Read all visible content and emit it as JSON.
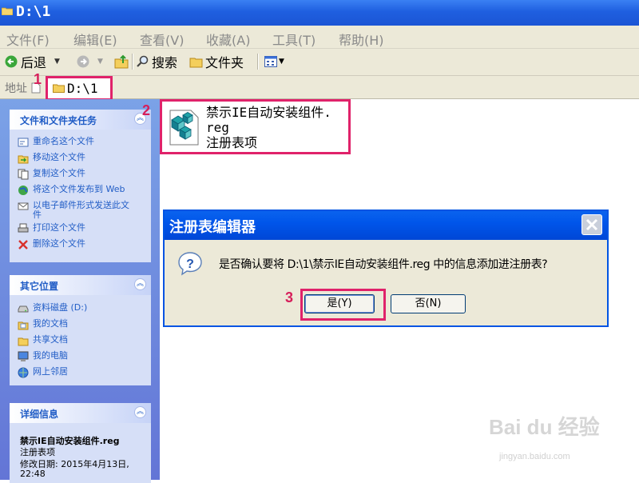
{
  "window": {
    "title": "D:\\1"
  },
  "menu": [
    "文件(F)",
    "编辑(E)",
    "查看(V)",
    "收藏(A)",
    "工具(T)",
    "帮助(H)"
  ],
  "toolbar": {
    "back": "后退",
    "search": "搜索",
    "folders": "文件夹"
  },
  "address": {
    "label": "地址",
    "value": "D:\\1"
  },
  "annotations": {
    "step1": "1",
    "step2": "2",
    "step3": "3"
  },
  "panel": {
    "tasks": {
      "title": "文件和文件夹任务",
      "items": [
        "重命名这个文件",
        "移动这个文件",
        "复制这个文件",
        "将这个文件发布到 Web",
        "以电子邮件形式发送此文件",
        "打印这个文件",
        "删除这个文件"
      ]
    },
    "places": {
      "title": "其它位置",
      "items": [
        "资料磁盘 (D:)",
        "我的文档",
        "共享文档",
        "我的电脑",
        "网上邻居"
      ]
    },
    "details": {
      "title": "详细信息",
      "name": "禁示IE自动安装组件.reg",
      "type": "注册表项",
      "modified": "修改日期: 2015年4月13日,",
      "modified_time": "22:48"
    }
  },
  "file": {
    "name_line1": "禁示IE自动安装组件.",
    "name_line2": "reg",
    "type": "注册表项"
  },
  "dialog": {
    "title": "注册表编辑器",
    "message": "是否确认要将 D:\\1\\禁示IE自动安装组件.reg 中的信息添加进注册表?",
    "yes": "是(Y)",
    "no": "否(N)"
  },
  "watermark": {
    "brand": "Bai du 经验",
    "url": "jingyan.baidu.com"
  },
  "colors": {
    "accent": "#e0226a",
    "panel_link": "#215dc6",
    "title_bar": "#1f5fe0"
  }
}
